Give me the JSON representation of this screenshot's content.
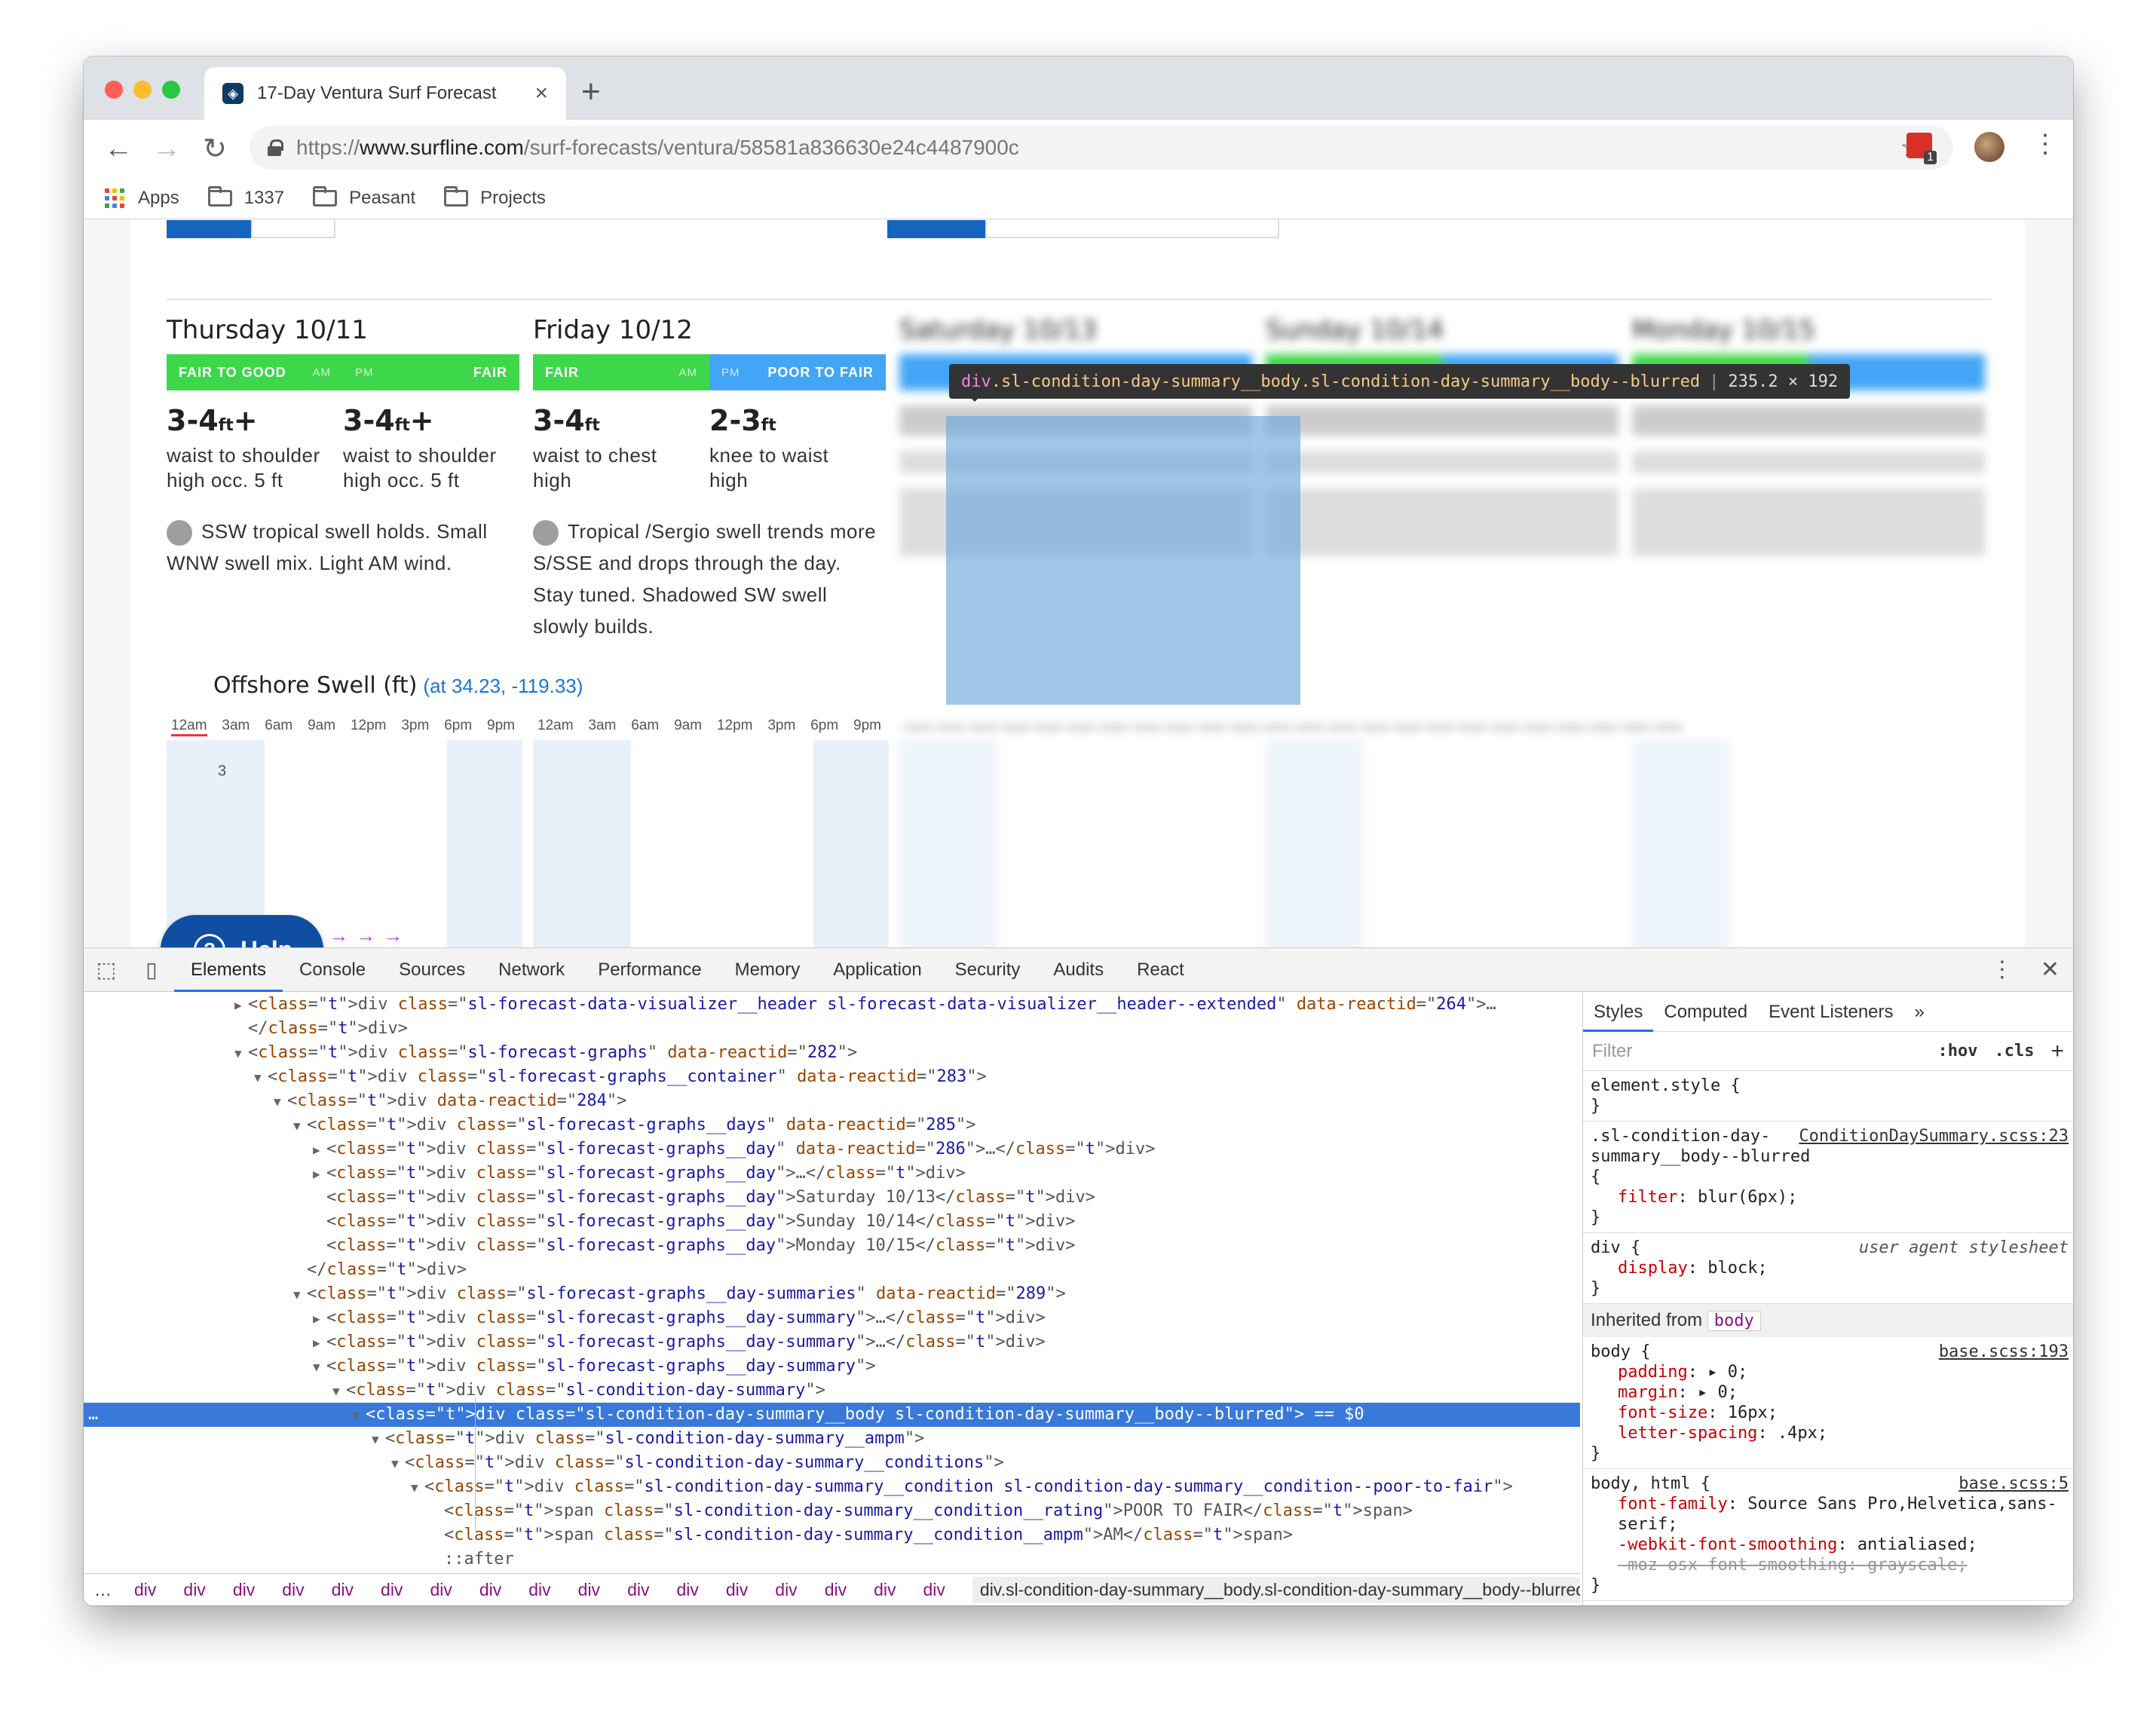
{
  "browser": {
    "tab_title": "17-Day Ventura Surf Forecast",
    "url_scheme": "https://",
    "url_host": "www.surfline.com",
    "url_path": "/surf-forecasts/ventura/58581a836630e24c4487900c",
    "extension_badge": "1",
    "bookmarks": [
      "Apps",
      "1337",
      "Peasant",
      "Projects"
    ]
  },
  "forecast": {
    "days": [
      {
        "name": "Thursday 10/11",
        "am_rating": "FAIR TO GOOD",
        "am_label": "AM",
        "pm_label": "PM",
        "pm_rating": "FAIR",
        "am_color": "#3ed74b",
        "pm_color": "#3ed74b",
        "am_height": "3-4",
        "am_unit": "ft",
        "am_plus": "+",
        "am_desc": "waist to shoulder",
        "am_occ": "high occ. 5 ft",
        "pm_height": "3-4",
        "pm_unit": "ft",
        "pm_plus": "+",
        "pm_desc": "waist to shoulder",
        "pm_occ": "high occ. 5 ft",
        "report": "SSW tropical swell holds. Small WNW swell mix. Light AM wind."
      },
      {
        "name": "Friday 10/12",
        "am_rating": "FAIR",
        "am_label": "AM",
        "pm_label": "PM",
        "pm_rating": "POOR TO FAIR",
        "am_color": "#3ed74b",
        "pm_color": "#42a5f5",
        "am_height": "3-4",
        "am_unit": "ft",
        "am_plus": "",
        "am_desc": "waist to chest",
        "am_occ": "high",
        "pm_height": "2-3",
        "pm_unit": "ft",
        "pm_plus": "",
        "pm_desc": "knee to waist",
        "pm_occ": "high",
        "report": "Tropical /Sergio swell trends more S/SSE and drops through the day. Stay tuned. Shadowed SW swell slowly builds."
      },
      {
        "name": "Saturday 10/13"
      },
      {
        "name": "Sunday 10/14"
      },
      {
        "name": "Monday 10/15"
      }
    ],
    "offshore_title": "Offshore Swell (ft)",
    "offshore_coords": "(at 34.23, -119.33)",
    "hours": [
      "12am",
      "3am",
      "6am",
      "9am",
      "12pm",
      "3pm",
      "6pm",
      "9pm"
    ],
    "y_value": "3",
    "help_label": "Help"
  },
  "inspector_tooltip": {
    "tag": "div",
    "classes": ".sl-condition-day-summary__body.sl-condition-day-summary__body--blurred",
    "dims": "235.2 × 192"
  },
  "devtools": {
    "tabs": [
      "Elements",
      "Console",
      "Sources",
      "Network",
      "Performance",
      "Memory",
      "Application",
      "Security",
      "Audits",
      "React"
    ],
    "active_tab": "Elements",
    "dom_lines": [
      {
        "indent": 18,
        "tri": "▶",
        "html": "<div class=\"sl-forecast-data-visualizer__header sl-forecast-data-visualizer__header--extended\" data-reactid=\"264\">…"
      },
      {
        "indent": 18,
        "tri": "",
        "html": "</div>"
      },
      {
        "indent": 18,
        "tri": "▼",
        "html": "<div class=\"sl-forecast-graphs\" data-reactid=\"282\">"
      },
      {
        "indent": 19,
        "tri": "▼",
        "html": "<div class=\"sl-forecast-graphs__container\" data-reactid=\"283\">"
      },
      {
        "indent": 20,
        "tri": "▼",
        "html": "<div data-reactid=\"284\">"
      },
      {
        "indent": 21,
        "tri": "▼",
        "html": "<div class=\"sl-forecast-graphs__days\" data-reactid=\"285\">"
      },
      {
        "indent": 22,
        "tri": "▶",
        "html": "<div class=\"sl-forecast-graphs__day\" data-reactid=\"286\">…</div>"
      },
      {
        "indent": 22,
        "tri": "▶",
        "html": "<div class=\"sl-forecast-graphs__day\">…</div>"
      },
      {
        "indent": 22,
        "tri": "",
        "html": "<div class=\"sl-forecast-graphs__day\">Saturday 10/13</div>"
      },
      {
        "indent": 22,
        "tri": "",
        "html": "<div class=\"sl-forecast-graphs__day\">Sunday 10/14</div>"
      },
      {
        "indent": 22,
        "tri": "",
        "html": "<div class=\"sl-forecast-graphs__day\">Monday 10/15</div>"
      },
      {
        "indent": 21,
        "tri": "",
        "html": "</div>"
      },
      {
        "indent": 21,
        "tri": "▼",
        "html": "<div class=\"sl-forecast-graphs__day-summaries\" data-reactid=\"289\">"
      },
      {
        "indent": 22,
        "tri": "▶",
        "html": "<div class=\"sl-forecast-graphs__day-summary\">…</div>"
      },
      {
        "indent": 22,
        "tri": "▶",
        "html": "<div class=\"sl-forecast-graphs__day-summary\">…</div>"
      },
      {
        "indent": 22,
        "tri": "▼",
        "html": "<div class=\"sl-forecast-graphs__day-summary\">"
      },
      {
        "indent": 23,
        "tri": "▼",
        "html": "<div class=\"sl-condition-day-summary\">"
      },
      {
        "indent": 24,
        "tri": "▼",
        "html": "<div class=\"sl-condition-day-summary__body sl-condition-day-summary__body--blurred\"> == $0",
        "selected": true
      },
      {
        "indent": 25,
        "tri": "▼",
        "html": "<div class=\"sl-condition-day-summary__ampm\">"
      },
      {
        "indent": 26,
        "tri": "▼",
        "html": "<div class=\"sl-condition-day-summary__conditions\">"
      },
      {
        "indent": 27,
        "tri": "▼",
        "html": "<div class=\"sl-condition-day-summary__condition sl-condition-day-summary__condition--poor-to-fair\">"
      },
      {
        "indent": 28,
        "tri": "",
        "html": "<span class=\"sl-condition-day-summary__condition__rating\">POOR TO FAIR</span>"
      },
      {
        "indent": 28,
        "tri": "",
        "html": "<span class=\"sl-condition-day-summary__condition__ampm\">AM</span>"
      },
      {
        "indent": 28,
        "tri": "",
        "html": "::after"
      }
    ],
    "breadcrumb": [
      "div",
      "div",
      "div",
      "div",
      "div",
      "div",
      "div",
      "div",
      "div",
      "div",
      "div",
      "div",
      "div",
      "div",
      "div",
      "div",
      "div"
    ],
    "breadcrumb_last": "div.sl-condition-day-summary__body.sl-condition-day-summary__body--blurred",
    "styles_tabs": [
      "Styles",
      "Computed",
      "Event Listeners"
    ],
    "filter_placeholder": "Filter",
    "hov": ":hov",
    "cls": ".cls",
    "rules": [
      {
        "selector": "element.style {",
        "source": "",
        "props": []
      },
      {
        "selector": ".sl-condition-day-summary__body--blurred {",
        "source": "ConditionDaySummary.scss:23",
        "props": [
          [
            "filter",
            "blur(6px)"
          ]
        ]
      },
      {
        "selector": "div {",
        "source": "user agent stylesheet",
        "props": [
          [
            "display",
            "block"
          ]
        ]
      }
    ],
    "inherited_label": "Inherited from",
    "inherited_tag": "body",
    "body_rule": {
      "selector": "body {",
      "source": "base.scss:193",
      "props": [
        [
          "padding",
          "▸ 0"
        ],
        [
          "margin",
          "▸ 0"
        ],
        [
          "font-size",
          "16px"
        ],
        [
          "letter-spacing",
          ".4px"
        ]
      ]
    },
    "html_rule": {
      "selector": "body, html {",
      "source": "base.scss:5",
      "props": [
        [
          "font-family",
          "Source Sans Pro,Helvetica,sans-serif"
        ],
        [
          "-webkit-font-smoothing",
          "antialiased"
        ]
      ],
      "struck": "-moz-osx-font-smoothing: grayscale;"
    }
  }
}
